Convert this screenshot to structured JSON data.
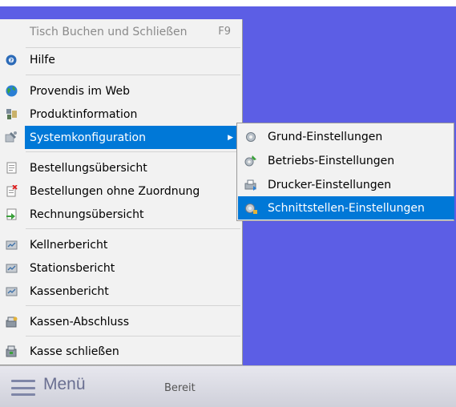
{
  "main_menu": {
    "items": [
      {
        "label": "Tisch Buchen und Schließen",
        "shortcut": "F9",
        "disabled": true
      },
      {
        "label": "Hilfe"
      },
      {
        "label": "Provendis im Web"
      },
      {
        "label": "Produktinformation"
      },
      {
        "label": "Systemkonfiguration",
        "has_submenu": true,
        "selected": true
      },
      {
        "label": "Bestellungsübersicht"
      },
      {
        "label": "Bestellungen ohne Zuordnung"
      },
      {
        "label": "Rechnungsübersicht"
      },
      {
        "label": "Kellnerbericht"
      },
      {
        "label": "Stationsbericht"
      },
      {
        "label": "Kassenbericht"
      },
      {
        "label": "Kassen-Abschluss"
      },
      {
        "label": "Kasse schließen"
      }
    ]
  },
  "submenu": {
    "items": [
      {
        "label": "Grund-Einstellungen"
      },
      {
        "label": "Betriebs-Einstellungen"
      },
      {
        "label": "Drucker-Einstellungen"
      },
      {
        "label": "Schnittstellen-Einstellungen",
        "selected": true
      }
    ]
  },
  "statusbar": {
    "menu_label": "Menü",
    "status": "Bereit"
  },
  "colors": {
    "desktop": "#5c5ee5",
    "selection": "#0078d7"
  }
}
